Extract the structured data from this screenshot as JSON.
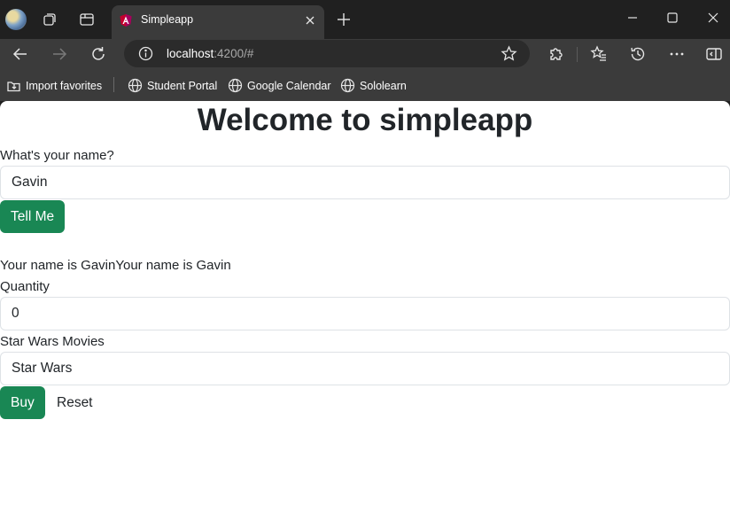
{
  "browser": {
    "tab": {
      "title": "Simpleapp"
    },
    "address": {
      "host": "localhost",
      "rest": ":4200/#"
    },
    "icons": {
      "workspaces": "workspaces-icon",
      "tab_actions": "tab-actions-icon",
      "back": "back-arrow-icon",
      "forward": "forward-arrow-icon",
      "refresh": "refresh-icon",
      "site_info": "info-icon",
      "favorite": "star-icon",
      "extensions": "extensions-icon",
      "favorites": "favorites-icon",
      "history": "history-icon",
      "more": "more-icon",
      "sidebar": "sidebar-icon"
    },
    "bookmarks": [
      {
        "label": "Import favorites",
        "icon": "import-icon"
      },
      {
        "label": "Student Portal",
        "icon": "globe-icon"
      },
      {
        "label": "Google Calendar",
        "icon": "globe-icon"
      },
      {
        "label": "Sololearn",
        "icon": "globe-icon"
      }
    ]
  },
  "page": {
    "title": "Welcome to simpleapp",
    "name_label": "What's your name?",
    "name_value": "Gavin",
    "tell_button": "Tell Me",
    "result_text": "Your name is GavinYour name is Gavin",
    "quantity_label": "Quantity",
    "quantity_value": "0",
    "movies_label": "Star Wars Movies",
    "movies_value": "Star Wars",
    "buy_button": "Buy",
    "reset_button": "Reset"
  },
  "colors": {
    "success": "#198754",
    "chrome_dark": "#202020",
    "chrome_mid": "#3b3b3b"
  }
}
